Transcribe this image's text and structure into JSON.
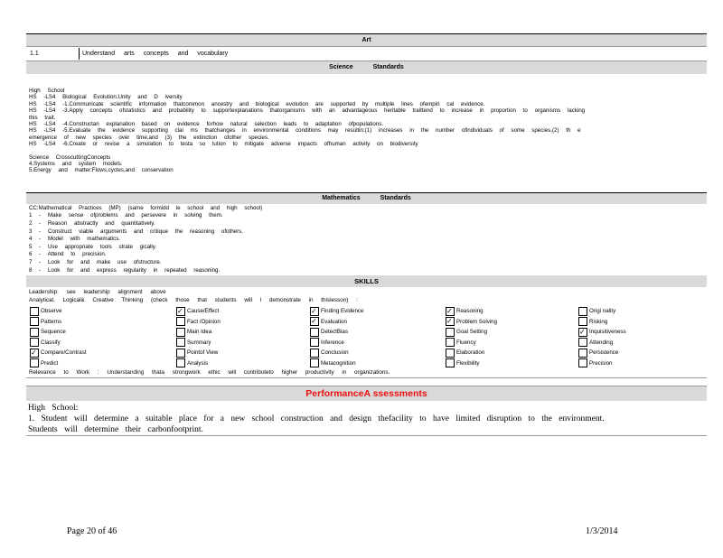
{
  "art": {
    "header": "Art",
    "row_number": "1.1",
    "row_text": "Understand arts concepts and vocabulary"
  },
  "science": {
    "header_left": "Science",
    "header_right": "Standards",
    "lines": [
      "High School",
      "HS -LS4 Biological Evolution:Unity and D iversity",
      "HS -LS4 -1.Communicate scientific information thatcommon ancestry and biological evolution are supported by multiple lines ofempiri cal evidence.",
      "HS -LS4 -3.Apply concepts ofstatistics and probability to supportexplanations thatorganisms with an advantageous heritable traittend to increase in proportion to organisms lacking",
      "this trait.",
      "HS -LS4 -4.Constructan explanation based on evidence forhow natural selection leads to adaptation ofpopulations.",
      "HS -LS4 -5.Evaluate the evidence supporting clai ms thatchanges in environmental conditions may resultin:(1) increases in the number ofindividuals of some species,(2) th e",
      "emergence of new species over time,and (3) the extinction ofother species.",
      "HS -LS4 -6.Create or revise a simulation to testa so lution to mitigate adverse impacts ofhuman activity on biodiversity",
      "",
      "Science CrosscuttingConcepts",
      "4.Systems and system models.",
      "5.Energy and matter:Flows,cycles,and conservation"
    ]
  },
  "math": {
    "header_left": "Mathematics",
    "header_right": "Standards",
    "lines": [
      "CC:Mathematical Practices (MP) (same formidd le school and high school)",
      "1 - Make sense ofproblems and persevere in solving them.",
      "2 - Reason abstractly and quantitatively.",
      "3 - Construct viable arguments and critique the reasoning ofothers.",
      "4 - Model with mathematics.",
      "5 - Use appropriate tools strate gically.",
      "6 - Attend to precision.",
      "7 - Look for and make use ofstructure.",
      "8 - Look for and express regularity in repeated reasoning."
    ]
  },
  "skills": {
    "header": "SKILLS",
    "leadership": "Leadership: see leadership alignment above",
    "analytical": "Analytical, Logical& Creative Thinking (check those that students will l demonstrate in thislesson) :",
    "columns": [
      [
        {
          "label": "Observe",
          "checked": false
        },
        {
          "label": "Patterns",
          "checked": false
        },
        {
          "label": "Sequence",
          "checked": false
        },
        {
          "label": "Classify",
          "checked": false
        },
        {
          "label": "Compare/Contrast",
          "checked": true
        },
        {
          "label": "Predict",
          "checked": false
        }
      ],
      [
        {
          "label": "Cause/Effect",
          "checked": true
        },
        {
          "label": "Fact /Opinion",
          "checked": false
        },
        {
          "label": "Main Idea",
          "checked": false
        },
        {
          "label": "Summary",
          "checked": false
        },
        {
          "label": "Pointof View",
          "checked": false
        },
        {
          "label": "Analysis",
          "checked": false
        }
      ],
      [
        {
          "label": "Finding Evidence",
          "checked": true
        },
        {
          "label": "Evaluation",
          "checked": true
        },
        {
          "label": "DetectBias",
          "checked": false
        },
        {
          "label": "Inference",
          "checked": false
        },
        {
          "label": "Conclusion",
          "checked": false
        },
        {
          "label": "Metacognition",
          "checked": false
        }
      ],
      [
        {
          "label": "Reasoning",
          "checked": true
        },
        {
          "label": "Problem Solving",
          "checked": true
        },
        {
          "label": "Goal Setting",
          "checked": false
        },
        {
          "label": "Fluency",
          "checked": false
        },
        {
          "label": "Elaboration",
          "checked": false
        },
        {
          "label": "Flexibility",
          "checked": false
        }
      ],
      [
        {
          "label": "Origi nality",
          "checked": false
        },
        {
          "label": "Risking",
          "checked": false
        },
        {
          "label": "Inquisitiveness",
          "checked": true
        },
        {
          "label": "Attending",
          "checked": false
        },
        {
          "label": "Persistence",
          "checked": false
        },
        {
          "label": "Precision",
          "checked": false
        }
      ]
    ],
    "relevance": "Relevance to Work : Understanding thata strongwork ethic will contributeto higher productivity in organizations."
  },
  "performance": {
    "header": "PerformanceA ssessments",
    "lines": [
      "High School:",
      "1. Student will determine a suitable place for a new school construction and design thefacility to have limited disruption to the environment.",
      "Students will determine their carbonfootprint."
    ]
  },
  "footer": {
    "page": "Page 20 of 46",
    "date": "1/3/2014"
  }
}
